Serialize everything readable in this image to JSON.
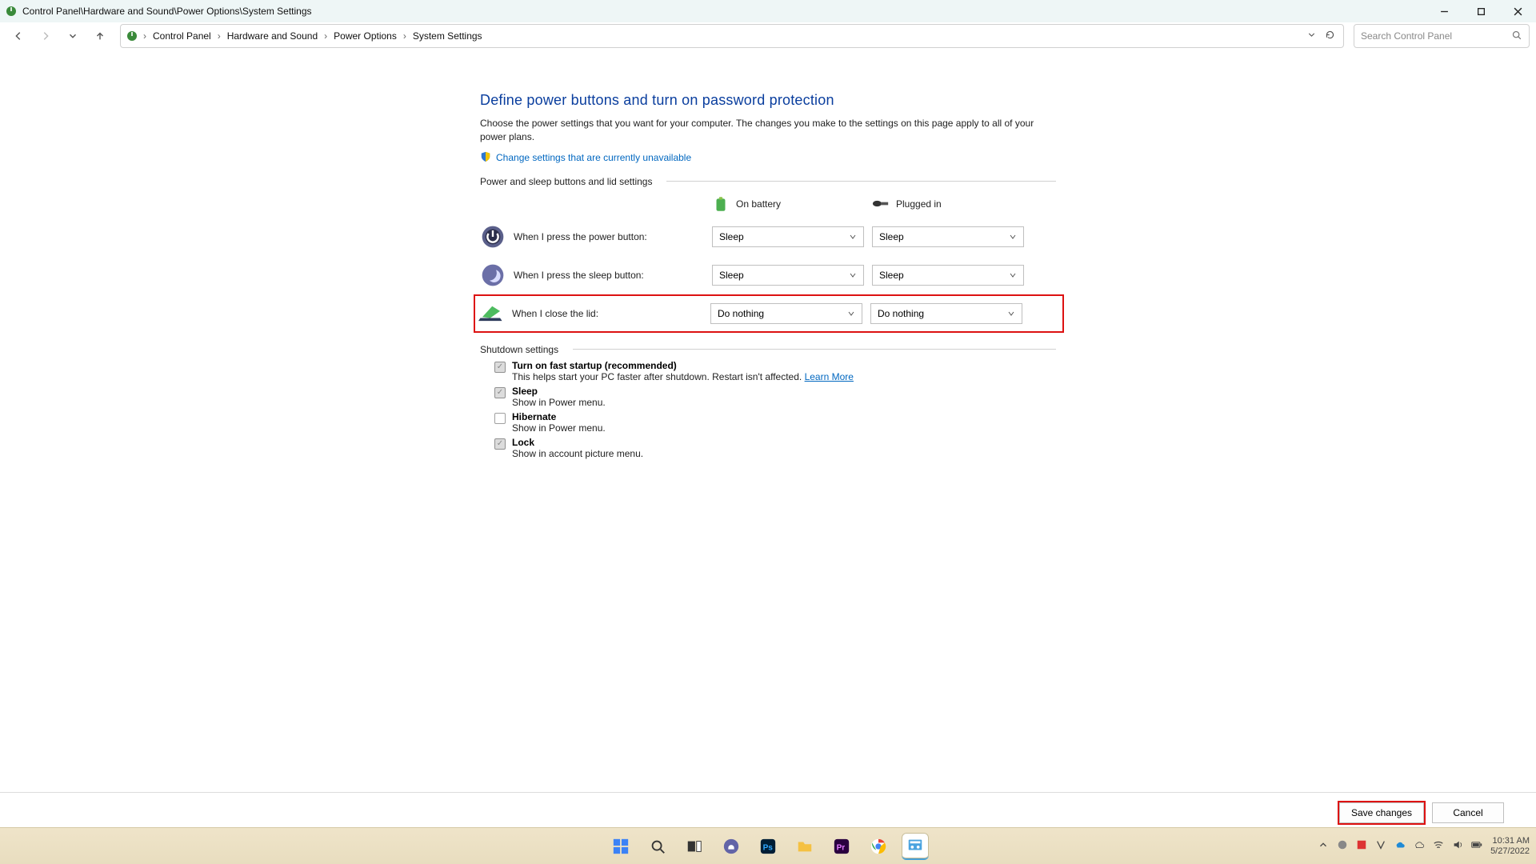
{
  "titlebar": {
    "path": "Control Panel\\Hardware and Sound\\Power Options\\System Settings"
  },
  "breadcrumb": {
    "items": [
      "Control Panel",
      "Hardware and Sound",
      "Power Options",
      "System Settings"
    ]
  },
  "search": {
    "placeholder": "Search Control Panel"
  },
  "heading": "Define power buttons and turn on password protection",
  "description": "Choose the power settings that you want for your computer. The changes you make to the settings on this page apply to all of your power plans.",
  "unlock_link": "Change settings that are currently unavailable",
  "section_power": "Power and sleep buttons and lid settings",
  "columns": {
    "battery": "On battery",
    "plugged": "Plugged in"
  },
  "rows": {
    "power_button": {
      "label": "When I press the power button:",
      "battery": "Sleep",
      "plugged": "Sleep"
    },
    "sleep_button": {
      "label": "When I press the sleep button:",
      "battery": "Sleep",
      "plugged": "Sleep"
    },
    "close_lid": {
      "label": "When I close the lid:",
      "battery": "Do nothing",
      "plugged": "Do nothing"
    }
  },
  "section_shutdown": "Shutdown settings",
  "shutdown": {
    "fast_startup": {
      "title": "Turn on fast startup (recommended)",
      "sub_prefix": "This helps start your PC faster after shutdown. Restart isn't affected. ",
      "learn_more": "Learn More",
      "checked": true
    },
    "sleep": {
      "title": "Sleep",
      "sub": "Show in Power menu.",
      "checked": true
    },
    "hibernate": {
      "title": "Hibernate",
      "sub": "Show in Power menu.",
      "checked": false
    },
    "lock": {
      "title": "Lock",
      "sub": "Show in account picture menu.",
      "checked": true
    }
  },
  "footer": {
    "save": "Save changes",
    "cancel": "Cancel"
  },
  "tray": {
    "time": "10:31 AM",
    "date": "5/27/2022"
  }
}
